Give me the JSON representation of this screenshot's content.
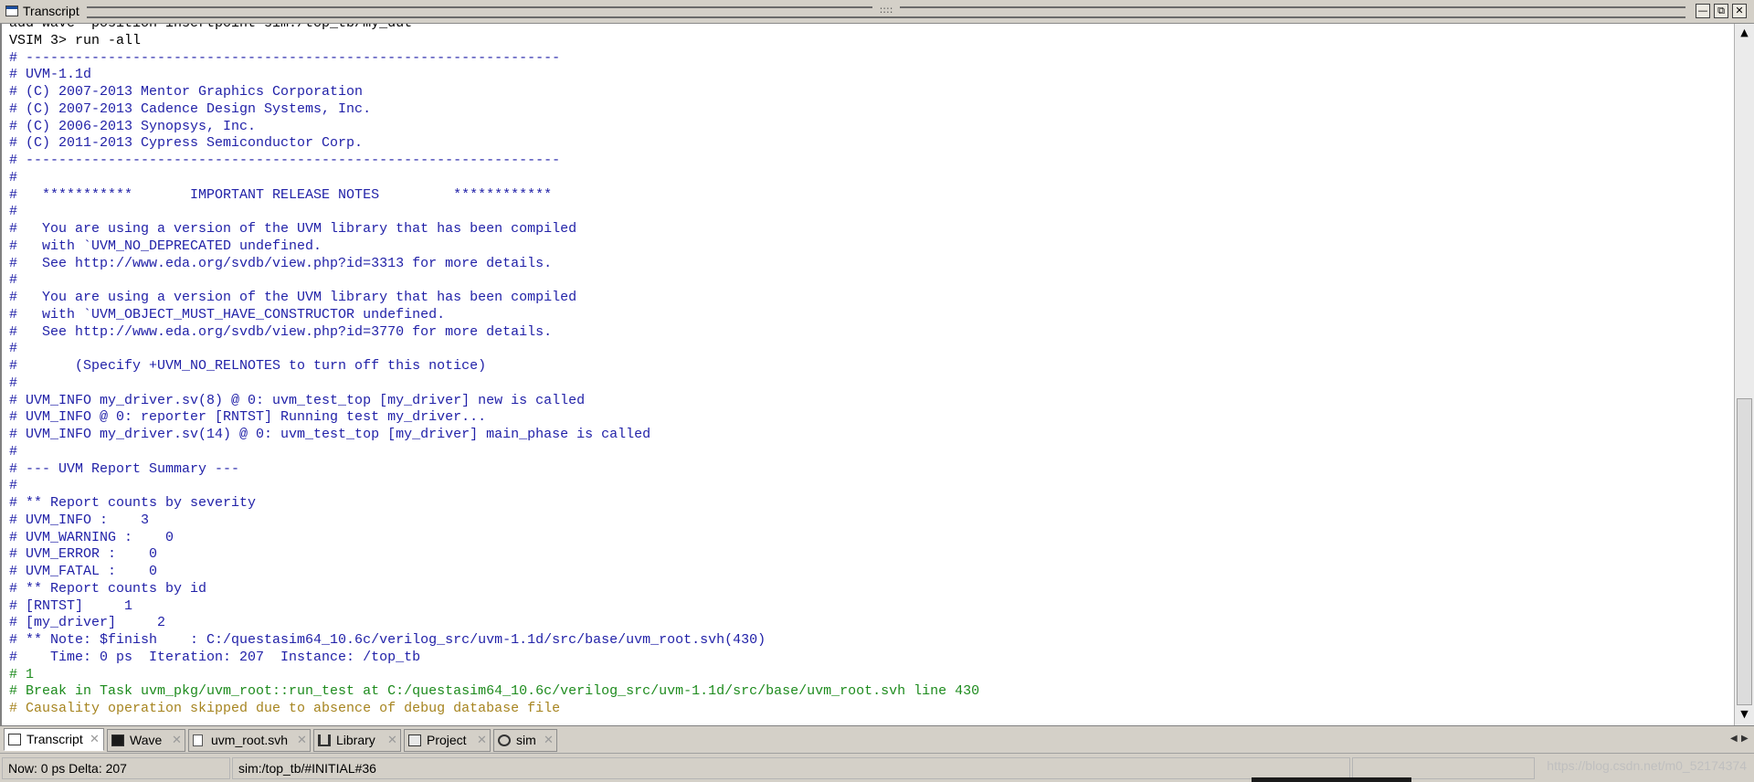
{
  "window": {
    "title": "Transcript",
    "grip": "::::",
    "buttons": {
      "minimize": "—",
      "restore": "⧉",
      "close": "✕"
    }
  },
  "transcript": {
    "partial_top_line": "add wave -position insertpoint sim:/top_tb/my_dut",
    "lines": [
      {
        "text": "VSIM 3> run -all",
        "color": "black"
      },
      {
        "text": "# -----------------------------------------------------------------",
        "color": "blue"
      },
      {
        "text": "# UVM-1.1d",
        "color": "blue"
      },
      {
        "text": "# (C) 2007-2013 Mentor Graphics Corporation",
        "color": "blue"
      },
      {
        "text": "# (C) 2007-2013 Cadence Design Systems, Inc.",
        "color": "blue"
      },
      {
        "text": "# (C) 2006-2013 Synopsys, Inc.",
        "color": "blue"
      },
      {
        "text": "# (C) 2011-2013 Cypress Semiconductor Corp.",
        "color": "blue"
      },
      {
        "text": "# -----------------------------------------------------------------",
        "color": "blue"
      },
      {
        "text": "#",
        "color": "blue"
      },
      {
        "text": "#   ***********       IMPORTANT RELEASE NOTES         ************",
        "color": "blue"
      },
      {
        "text": "#",
        "color": "blue"
      },
      {
        "text": "#   You are using a version of the UVM library that has been compiled",
        "color": "blue"
      },
      {
        "text": "#   with `UVM_NO_DEPRECATED undefined.",
        "color": "blue"
      },
      {
        "text": "#   See http://www.eda.org/svdb/view.php?id=3313 for more details.",
        "color": "blue"
      },
      {
        "text": "#",
        "color": "blue"
      },
      {
        "text": "#   You are using a version of the UVM library that has been compiled",
        "color": "blue"
      },
      {
        "text": "#   with `UVM_OBJECT_MUST_HAVE_CONSTRUCTOR undefined.",
        "color": "blue"
      },
      {
        "text": "#   See http://www.eda.org/svdb/view.php?id=3770 for more details.",
        "color": "blue"
      },
      {
        "text": "#",
        "color": "blue"
      },
      {
        "text": "#       (Specify +UVM_NO_RELNOTES to turn off this notice)",
        "color": "blue"
      },
      {
        "text": "#",
        "color": "blue"
      },
      {
        "text": "# UVM_INFO my_driver.sv(8) @ 0: uvm_test_top [my_driver] new is called",
        "color": "blue"
      },
      {
        "text": "# UVM_INFO @ 0: reporter [RNTST] Running test my_driver...",
        "color": "blue"
      },
      {
        "text": "# UVM_INFO my_driver.sv(14) @ 0: uvm_test_top [my_driver] main_phase is called",
        "color": "blue"
      },
      {
        "text": "#",
        "color": "blue"
      },
      {
        "text": "# --- UVM Report Summary ---",
        "color": "blue"
      },
      {
        "text": "#",
        "color": "blue"
      },
      {
        "text": "# ** Report counts by severity",
        "color": "blue"
      },
      {
        "text": "# UVM_INFO :    3",
        "color": "blue"
      },
      {
        "text": "# UVM_WARNING :    0",
        "color": "blue"
      },
      {
        "text": "# UVM_ERROR :    0",
        "color": "blue"
      },
      {
        "text": "# UVM_FATAL :    0",
        "color": "blue"
      },
      {
        "text": "# ** Report counts by id",
        "color": "blue"
      },
      {
        "text": "# [RNTST]     1",
        "color": "blue"
      },
      {
        "text": "# [my_driver]     2",
        "color": "blue"
      },
      {
        "text": "# ** Note: $finish    : C:/questasim64_10.6c/verilog_src/uvm-1.1d/src/base/uvm_root.svh(430)",
        "color": "blue"
      },
      {
        "text": "#    Time: 0 ps  Iteration: 207  Instance: /top_tb",
        "color": "blue"
      },
      {
        "text": "# 1",
        "color": "green"
      },
      {
        "text": "# Break in Task uvm_pkg/uvm_root::run_test at C:/questasim64_10.6c/verilog_src/uvm-1.1d/src/base/uvm_root.svh line 430",
        "color": "green"
      },
      {
        "text": "# Causality operation skipped due to absence of debug database file",
        "color": "orange"
      }
    ]
  },
  "scrollbar": {
    "up": "▲",
    "down": "▼",
    "position_fraction": 0.56
  },
  "tabs": [
    {
      "label": "Transcript",
      "icon": "transcript-icon",
      "active": true
    },
    {
      "label": "Wave",
      "icon": "wave-icon",
      "active": false
    },
    {
      "label": "uvm_root.svh",
      "icon": "file-icon",
      "active": false
    },
    {
      "label": "Library",
      "icon": "library-icon",
      "active": false
    },
    {
      "label": "Project",
      "icon": "project-icon",
      "active": false
    },
    {
      "label": "sim",
      "icon": "sim-icon",
      "active": false
    }
  ],
  "tab_close": "✕",
  "tab_nav": {
    "left": "◀",
    "right": "▶"
  },
  "status": {
    "now": "Now: 0 ps  Delta: 207",
    "context": "sim:/top_tb/#INITIAL#36",
    "watermark": "https://blog.csdn.net/m0_52174374"
  },
  "colors": {
    "blue": "#2121a8",
    "black": "#000000",
    "green": "#1d8b1d",
    "orange": "#a6841f"
  }
}
